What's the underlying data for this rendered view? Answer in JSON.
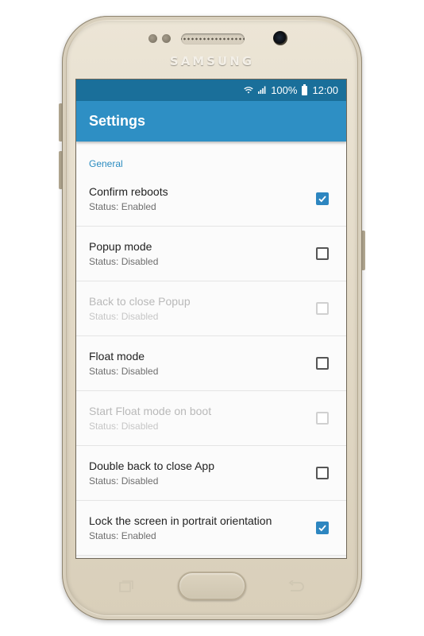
{
  "device": {
    "brand": "SAMSUNG"
  },
  "status_bar": {
    "battery": "100%",
    "time": "12:00",
    "icons": [
      "wifi-icon",
      "signal-icon",
      "battery-icon"
    ]
  },
  "app_bar": {
    "title": "Settings"
  },
  "section": {
    "header": "General"
  },
  "preferences": [
    {
      "title": "Confirm reboots",
      "status": "Status: Enabled",
      "checked": true,
      "enabled": true
    },
    {
      "title": "Popup mode",
      "status": "Status: Disabled",
      "checked": false,
      "enabled": true
    },
    {
      "title": "Back to close Popup",
      "status": "Status: Disabled",
      "checked": false,
      "enabled": false
    },
    {
      "title": "Float mode",
      "status": "Status: Disabled",
      "checked": false,
      "enabled": true
    },
    {
      "title": "Start Float mode on boot",
      "status": "Status: Disabled",
      "checked": false,
      "enabled": false
    },
    {
      "title": "Double back to close App",
      "status": "Status: Disabled",
      "checked": false,
      "enabled": true
    },
    {
      "title": "Lock the screen in portrait orientation",
      "status": "Status: Enabled",
      "checked": true,
      "enabled": true
    }
  ],
  "colors": {
    "status_bar": "#1a6f9a",
    "app_bar": "#2e8fc4",
    "accent": "#2d86c0"
  }
}
